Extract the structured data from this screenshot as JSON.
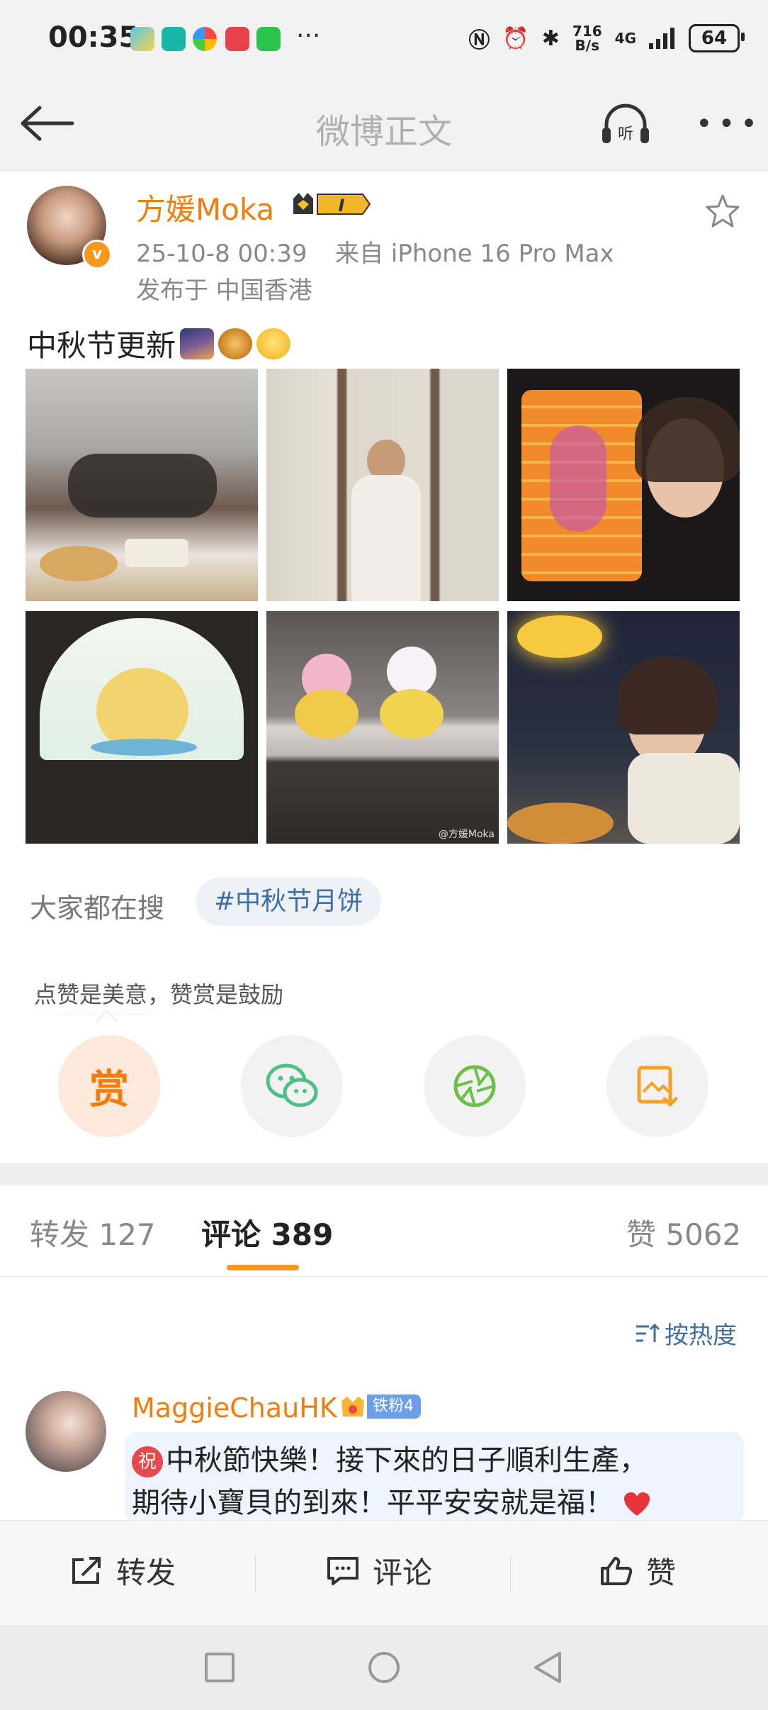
{
  "status_bar": {
    "time": "00:35",
    "more_indicator": "···",
    "net_speed_value": "716",
    "net_speed_unit": "B/s",
    "network": "4G",
    "battery": "64"
  },
  "header": {
    "title": "微博正文",
    "listen_icon_text": "听"
  },
  "post": {
    "author_name": "方媛Moka",
    "verified_mark": "v",
    "vip_level": "I",
    "datetime": "25-10-8 00:39",
    "source": "来自 iPhone 16 Pro Max",
    "location": "发布于 中国香港",
    "text": "中秋节更新",
    "watermark": "@方媛Moka"
  },
  "search": {
    "label": "大家都在搜",
    "topic": "#中秋节月饼"
  },
  "reward": {
    "tip": "点赞是美意，赞赏是鼓励",
    "button_label": "赏"
  },
  "tabs": {
    "repost": "转发 127",
    "comment": "评论 389",
    "like": "赞 5062"
  },
  "sort": {
    "label": "按热度"
  },
  "comment": {
    "user": "MaggieChauHK",
    "fan_badge": "铁粉4",
    "prefix_badge": "祝",
    "line1": "中秋節快樂！接下來的日子順利生產，",
    "line2": "期待小寶貝的到來！平平安安就是福！"
  },
  "bottom_bar": {
    "repost": "转发",
    "comment": "评论",
    "like": "赞"
  },
  "colors": {
    "accent_orange": "#f17e0c",
    "link_blue": "#3f6ea5"
  }
}
